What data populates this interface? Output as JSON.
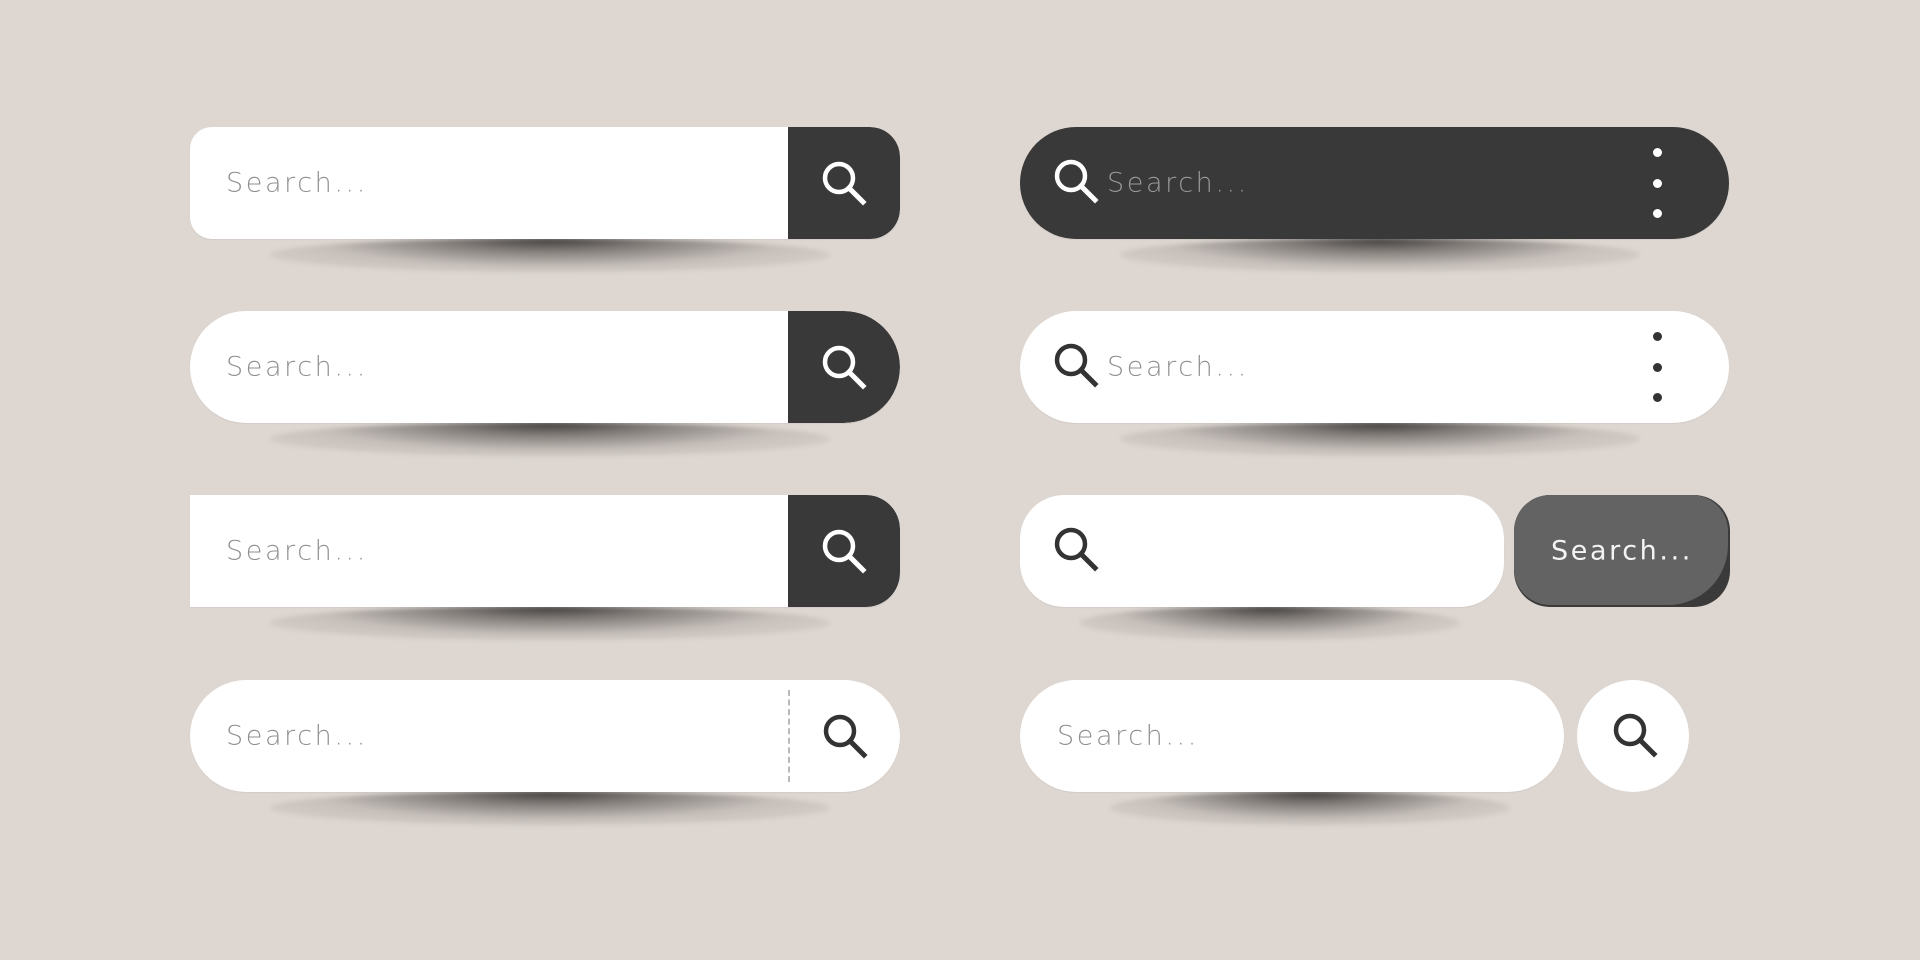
{
  "colors": {
    "background": "#ddd6d1",
    "bar_white": "#ffffff",
    "bar_dark": "#393939",
    "button_dark": "#393939",
    "button_gray": "#636363",
    "button_gray_curl": "#3a3a3a",
    "placeholder_text": "#8e8e8e",
    "icon_dark": "#333333",
    "icon_light": "#ffffff"
  },
  "search_bars": [
    {
      "id": "left-1",
      "style": "white-rounded-with-dark-square-button",
      "placeholder": "Search...",
      "search_icon": "search-icon",
      "button_icon_color": "#ffffff"
    },
    {
      "id": "left-2",
      "style": "white-pill-with-dark-button",
      "placeholder": "Search...",
      "search_icon": "search-icon",
      "button_icon_color": "#ffffff"
    },
    {
      "id": "left-3",
      "style": "white-square-with-dark-rounded-button",
      "placeholder": "Search...",
      "search_icon": "search-icon",
      "button_icon_color": "#ffffff"
    },
    {
      "id": "left-4",
      "style": "white-pill-with-dashed-divider",
      "placeholder": "Search...",
      "search_icon": "search-icon",
      "button_icon_color": "#333333"
    },
    {
      "id": "right-1",
      "style": "dark-pill-with-leading-icon-and-menu",
      "placeholder": "Search...",
      "search_icon": "search-icon",
      "menu_icon": "kebab-menu-icon"
    },
    {
      "id": "right-2",
      "style": "white-pill-with-leading-icon-and-menu",
      "placeholder": "Search...",
      "search_icon": "search-icon",
      "menu_icon": "kebab-menu-icon"
    },
    {
      "id": "right-3",
      "style": "white-pill-with-icon-and-separate-text-button",
      "placeholder": "",
      "search_icon": "search-icon",
      "button_label": "Search..."
    },
    {
      "id": "right-4",
      "style": "white-pill-with-separate-circle-button",
      "placeholder": "Search...",
      "search_icon": "search-icon"
    }
  ]
}
